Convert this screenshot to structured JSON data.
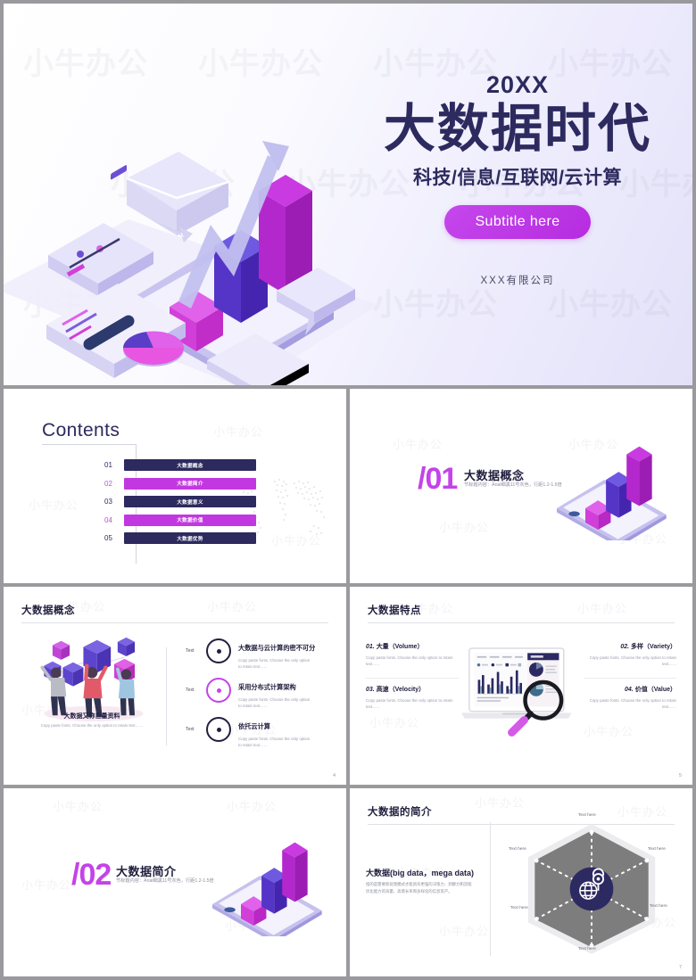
{
  "hero": {
    "year": "20XX",
    "title": "大数据时代",
    "subtitle": "科技/信息/互联网/云计算",
    "button_label": "Subtitle here",
    "organization": "XXX有限公司",
    "accent_color": "#c443e8",
    "navy_color": "#2c2a5e"
  },
  "watermark": "小牛办公",
  "contents": {
    "heading": "Contents",
    "items": [
      {
        "num": "01",
        "label": "大数据概念",
        "highlight": false
      },
      {
        "num": "02",
        "label": "大数据简介",
        "highlight": true
      },
      {
        "num": "03",
        "label": "大数据意义",
        "highlight": false
      },
      {
        "num": "04",
        "label": "大数据价值",
        "highlight": true
      },
      {
        "num": "05",
        "label": "大数据优势",
        "highlight": false
      }
    ]
  },
  "section_01": {
    "number": "/01",
    "title": "大数据概念",
    "note": "节标题内容：Arial细黑11号灰色，行距1.2-1.5倍"
  },
  "section_02": {
    "number": "/02",
    "title": "大数据简介",
    "note": "节标题内容：Arial细黑11号灰色，行距1.2-1.5倍"
  },
  "slide_concept": {
    "title": "大数据概念",
    "page": "4",
    "illustration_caption": "大数据又称巨量资料",
    "illustration_desc": "Copy paste fonts. Choose the only option to retain text……",
    "rows": [
      {
        "tag": "Text",
        "heading": "大数据与云计算的密不可分",
        "body": "Copy paste fonts. Choose the only option to retain text……",
        "highlight": false
      },
      {
        "tag": "Text",
        "heading": "采用分布式计算架构",
        "body": "Copy paste fonts. Choose the only option to retain text……",
        "highlight": true
      },
      {
        "tag": "Text",
        "heading": "依托云计算",
        "body": "Copy paste fonts. Choose the only option to retain text……",
        "highlight": false
      }
    ]
  },
  "slide_features": {
    "title": "大数据特点",
    "page": "5",
    "items": [
      {
        "num": "01.",
        "cn": "大量",
        "en": "（Volume）",
        "body": "Copy paste fonts. Choose the only option to retain text……"
      },
      {
        "num": "02.",
        "cn": "多样",
        "en": "（Variety）",
        "body": "Copy paste fonts. Choose the only option to retain text……"
      },
      {
        "num": "03.",
        "cn": "高速",
        "en": "（Velocity）",
        "body": "Copy paste fonts. Choose the only option to retain text……"
      },
      {
        "num": "04.",
        "cn": "价值",
        "en": "（Value）",
        "body": "Copy paste fonts. Choose the only option to retain text……"
      }
    ]
  },
  "slide_intro": {
    "title": "大数据的简介",
    "page": "7",
    "heading_cn": "大数据",
    "heading_en": "(big data，mega data)",
    "body": "指的是需要新处理模式才能具有更强的决策力、洞察力和流程优化能力的海量、高增长率和多样化的信息资产。",
    "hex_labels": [
      "Text here",
      "Text here",
      "Text here",
      "Text here",
      "Text here",
      "Text here"
    ]
  }
}
